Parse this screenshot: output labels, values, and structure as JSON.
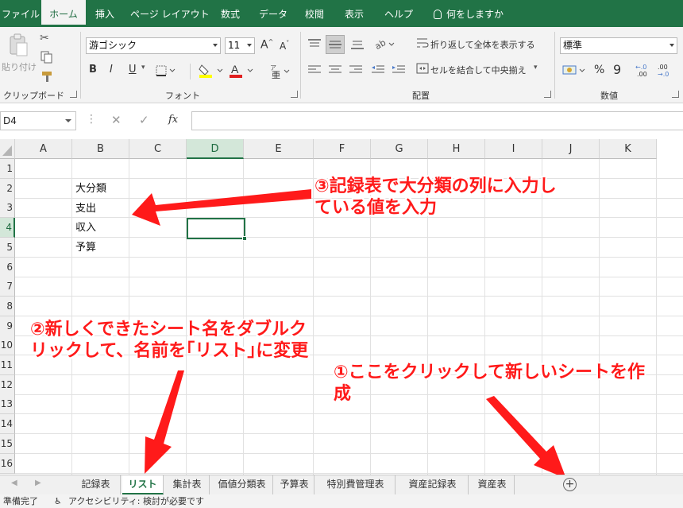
{
  "menu": {
    "tabs": [
      "ファイル",
      "ホーム",
      "挿入",
      "ページ レイアウト",
      "数式",
      "データ",
      "校閲",
      "表示",
      "ヘルプ"
    ],
    "search": "何をしますか"
  },
  "ribbon": {
    "clipboard": {
      "paste": "貼り付け",
      "label": "クリップボード"
    },
    "font": {
      "name": "游ゴシック",
      "size": "11",
      "bold": "B",
      "italic": "I",
      "underline": "U",
      "label": "フォント"
    },
    "alignment": {
      "wrap": "折り返して全体を表示する",
      "merge": "セルを結合して中央揃え",
      "label": "配置"
    },
    "number": {
      "format": "標準",
      "percent": "%",
      "comma": "9",
      "label": "数値"
    }
  },
  "formula_bar": {
    "name_box": "D4",
    "fx": "fx"
  },
  "grid": {
    "columns": [
      "A",
      "B",
      "C",
      "D",
      "E",
      "F",
      "G",
      "H",
      "I",
      "J",
      "K"
    ],
    "rows": [
      "1",
      "2",
      "3",
      "4",
      "5",
      "6",
      "7",
      "8",
      "9",
      "10",
      "11",
      "12",
      "13",
      "14",
      "15",
      "16"
    ],
    "selected_column": "D",
    "selected_row": "4",
    "cells": {
      "B2": "大分類",
      "B3": "支出",
      "B4": "収入",
      "B5": "予算"
    }
  },
  "annotations": {
    "note1_line1": "①ここをクリックして新しいシートを作",
    "note1_line2": "成",
    "note2_line1": "②新しくできたシート名をダブルク",
    "note2_line2": "リックして、名前を｢リスト｣に変更",
    "note3_line1": "③記録表で大分類の列に入力し",
    "note3_line2": "ている値を入力",
    "arrow_color": "#ff1a1a"
  },
  "sheet_tabs": [
    "記録表",
    "リスト",
    "集計表",
    "価値分類表",
    "予算表",
    "特別費管理表",
    "資産記録表",
    "資産表"
  ],
  "active_sheet": "リスト",
  "status": {
    "ready": "準備完了",
    "accessibility": "アクセシビリティ: 検討が必要です"
  },
  "colors": {
    "excel_green": "#217346",
    "annotation_red": "#ff1a1a"
  }
}
